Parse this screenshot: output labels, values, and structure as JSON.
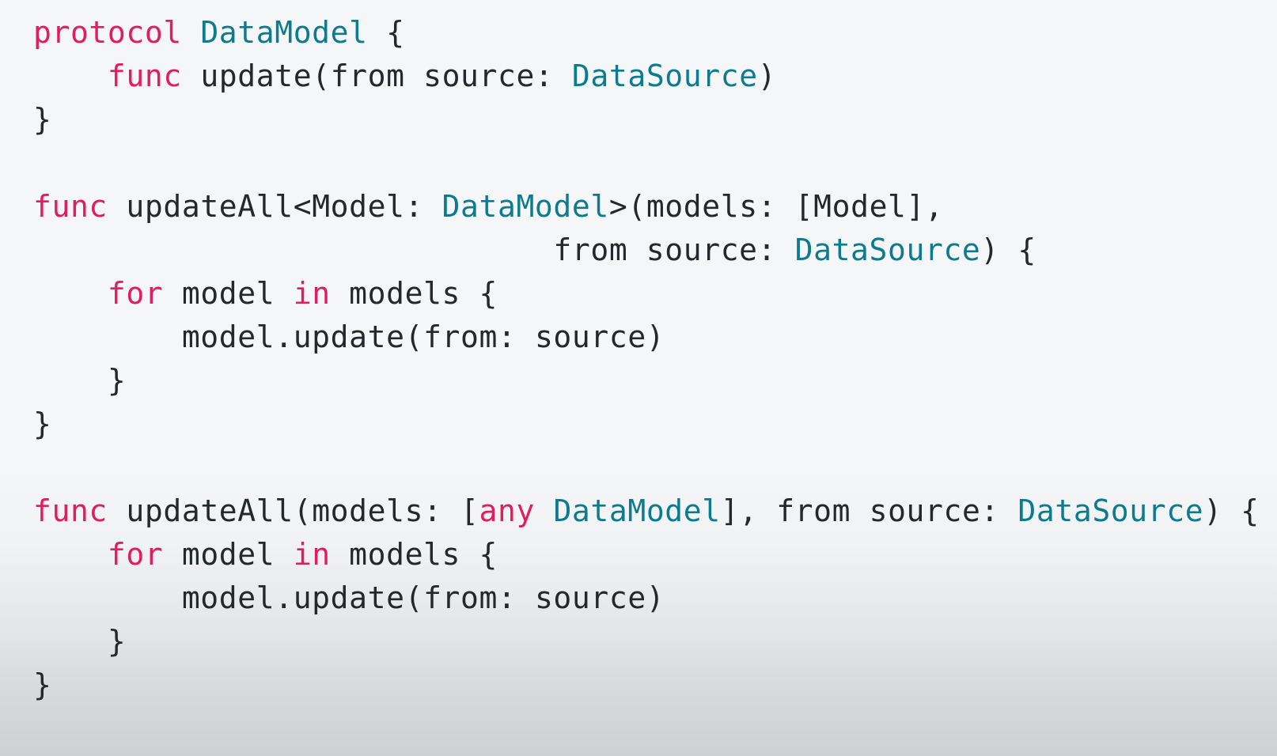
{
  "editor": {
    "language": "swift",
    "background_top": "#f5f6f7",
    "background_bottom": "#cfd0d2",
    "colors": {
      "keyword": "#e01e5f",
      "type": "#0d7b8e",
      "identifier": "#1aa7c4",
      "plain": "#25282b"
    }
  },
  "code": {
    "full_text": "protocol DataModel {\n    func update(from source: DataSource)\n}\n\nfunc updateAll<Model: DataModel>(models: [Model],\n                            from source: DataSource) {\n    for model in models {\n        model.update(from: source)\n    }\n}\n\nfunc updateAll(models: [any DataModel], from source: DataSource) {\n    for model in models {\n        model.update(from: source)\n    }\n}",
    "lines": [
      {
        "id": "line-1",
        "tokens": [
          {
            "t": "protocol",
            "k": "keyword"
          },
          {
            "t": " ",
            "k": "plain"
          },
          {
            "t": "DataModel",
            "k": "type"
          },
          {
            "t": " {",
            "k": "plain"
          }
        ]
      },
      {
        "id": "line-2",
        "tokens": [
          {
            "t": "    ",
            "k": "plain"
          },
          {
            "t": "func",
            "k": "keyword"
          },
          {
            "t": " ",
            "k": "plain"
          },
          {
            "t": "update",
            "k": "identifier"
          },
          {
            "t": "(",
            "k": "plain"
          },
          {
            "t": "from",
            "k": "identifier"
          },
          {
            "t": " source: ",
            "k": "plain"
          },
          {
            "t": "DataSource",
            "k": "type"
          },
          {
            "t": ")",
            "k": "plain"
          }
        ]
      },
      {
        "id": "line-3",
        "tokens": [
          {
            "t": "}",
            "k": "plain"
          }
        ]
      },
      {
        "id": "line-4",
        "tokens": []
      },
      {
        "id": "line-5",
        "tokens": [
          {
            "t": "func",
            "k": "keyword"
          },
          {
            "t": " ",
            "k": "plain"
          },
          {
            "t": "updateAll",
            "k": "identifier"
          },
          {
            "t": "<Model: ",
            "k": "plain"
          },
          {
            "t": "DataModel",
            "k": "type"
          },
          {
            "t": ">(",
            "k": "plain"
          },
          {
            "t": "models",
            "k": "identifier"
          },
          {
            "t": ": [Model],",
            "k": "plain"
          }
        ]
      },
      {
        "id": "line-6",
        "tokens": [
          {
            "t": "                            ",
            "k": "plain"
          },
          {
            "t": "from",
            "k": "identifier"
          },
          {
            "t": " source: ",
            "k": "plain"
          },
          {
            "t": "DataSource",
            "k": "type"
          },
          {
            "t": ") {",
            "k": "plain"
          }
        ]
      },
      {
        "id": "line-7",
        "tokens": [
          {
            "t": "    ",
            "k": "plain"
          },
          {
            "t": "for",
            "k": "keyword"
          },
          {
            "t": " model ",
            "k": "plain"
          },
          {
            "t": "in",
            "k": "keyword"
          },
          {
            "t": " models {",
            "k": "plain"
          }
        ]
      },
      {
        "id": "line-8",
        "tokens": [
          {
            "t": "        model.",
            "k": "plain"
          },
          {
            "t": "update",
            "k": "identifier"
          },
          {
            "t": "(",
            "k": "plain"
          },
          {
            "t": "from",
            "k": "identifier"
          },
          {
            "t": ": source)",
            "k": "plain"
          }
        ]
      },
      {
        "id": "line-9",
        "tokens": [
          {
            "t": "    }",
            "k": "plain"
          }
        ]
      },
      {
        "id": "line-10",
        "tokens": [
          {
            "t": "}",
            "k": "plain"
          }
        ]
      },
      {
        "id": "line-11",
        "tokens": []
      },
      {
        "id": "line-12",
        "tokens": [
          {
            "t": "func",
            "k": "keyword"
          },
          {
            "t": " ",
            "k": "plain"
          },
          {
            "t": "updateAll",
            "k": "identifier"
          },
          {
            "t": "(",
            "k": "plain"
          },
          {
            "t": "models",
            "k": "identifier"
          },
          {
            "t": ": [",
            "k": "plain"
          },
          {
            "t": "any",
            "k": "keyword"
          },
          {
            "t": " ",
            "k": "plain"
          },
          {
            "t": "DataModel",
            "k": "type"
          },
          {
            "t": "], ",
            "k": "plain"
          },
          {
            "t": "from",
            "k": "identifier"
          },
          {
            "t": " source: ",
            "k": "plain"
          },
          {
            "t": "DataSource",
            "k": "type"
          },
          {
            "t": ") {",
            "k": "plain"
          }
        ]
      },
      {
        "id": "line-13",
        "tokens": [
          {
            "t": "    ",
            "k": "plain"
          },
          {
            "t": "for",
            "k": "keyword"
          },
          {
            "t": " model ",
            "k": "plain"
          },
          {
            "t": "in",
            "k": "keyword"
          },
          {
            "t": " models {",
            "k": "plain"
          }
        ]
      },
      {
        "id": "line-14",
        "tokens": [
          {
            "t": "        model.",
            "k": "plain"
          },
          {
            "t": "update",
            "k": "identifier"
          },
          {
            "t": "(",
            "k": "plain"
          },
          {
            "t": "from",
            "k": "identifier"
          },
          {
            "t": ": source)",
            "k": "plain"
          }
        ]
      },
      {
        "id": "line-15",
        "tokens": [
          {
            "t": "    }",
            "k": "plain"
          }
        ]
      },
      {
        "id": "line-16",
        "tokens": [
          {
            "t": "}",
            "k": "plain"
          }
        ]
      }
    ]
  }
}
